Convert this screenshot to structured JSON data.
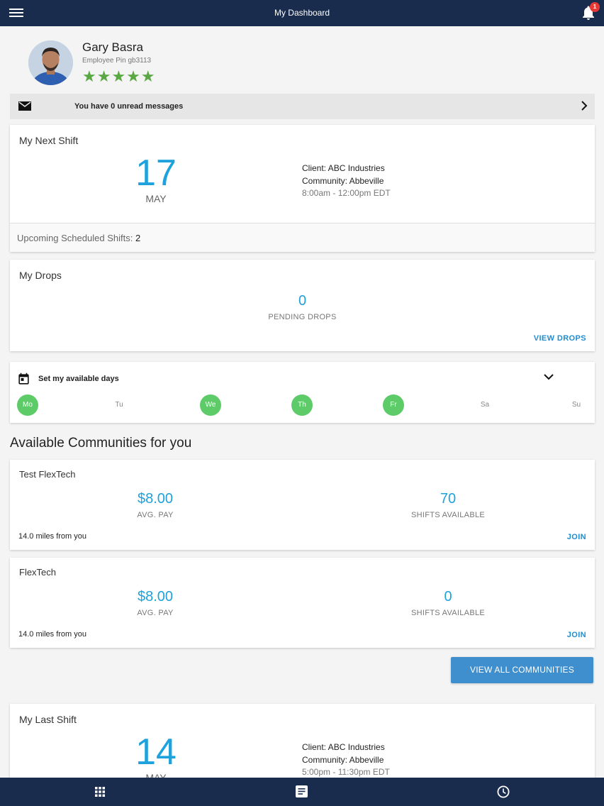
{
  "header": {
    "title": "My Dashboard",
    "notification_count": "1"
  },
  "profile": {
    "name": "Gary Basra",
    "pin": "Employee Pin gb3113",
    "stars": "★★★★★",
    "rating": 5
  },
  "messages": {
    "text": "You have 0 unread messages"
  },
  "next_shift": {
    "title": "My Next Shift",
    "day": "17",
    "month": "MAY",
    "client": "Client: ABC Industries",
    "community": "Community: Abbeville",
    "time": "8:00am - 12:00pm EDT",
    "upcoming_label": "Upcoming Scheduled Shifts: ",
    "upcoming_count": "2"
  },
  "drops": {
    "title": "My Drops",
    "count": "0",
    "label": "PENDING DROPS",
    "link": "VIEW DROPS"
  },
  "availability": {
    "title": "Set my available days",
    "days": [
      {
        "label": "Mo",
        "active": true
      },
      {
        "label": "Tu",
        "active": false
      },
      {
        "label": "We",
        "active": true
      },
      {
        "label": "Th",
        "active": true
      },
      {
        "label": "Fr",
        "active": true
      },
      {
        "label": "Sa",
        "active": false
      },
      {
        "label": "Su",
        "active": false
      }
    ]
  },
  "communities": {
    "title": "Available Communities for you",
    "items": [
      {
        "name": "Test FlexTech",
        "pay": "$8.00",
        "pay_label": "AVG. PAY",
        "shifts": "70",
        "shifts_label": "SHIFTS AVAILABLE",
        "distance": "14.0 miles from you",
        "join": "JOIN"
      },
      {
        "name": "FlexTech",
        "pay": "$8.00",
        "pay_label": "AVG. PAY",
        "shifts": "0",
        "shifts_label": "SHIFTS AVAILABLE",
        "distance": "14.0 miles from you",
        "join": "JOIN"
      }
    ],
    "view_all": "VIEW ALL COMMUNITIES"
  },
  "last_shift": {
    "title": "My Last Shift",
    "day": "14",
    "month": "MAY",
    "client": "Client: ABC Industries",
    "community": "Community: Abbeville",
    "time": "5:00pm - 11:30pm EDT"
  },
  "bottom_nav": [
    "grid-icon",
    "document-icon",
    "clock-icon"
  ],
  "colors": {
    "navy": "#1a2c4e",
    "accent": "#1fa2dc",
    "green": "#5ccb68",
    "star": "#5aa844",
    "button": "#3f8fce"
  }
}
